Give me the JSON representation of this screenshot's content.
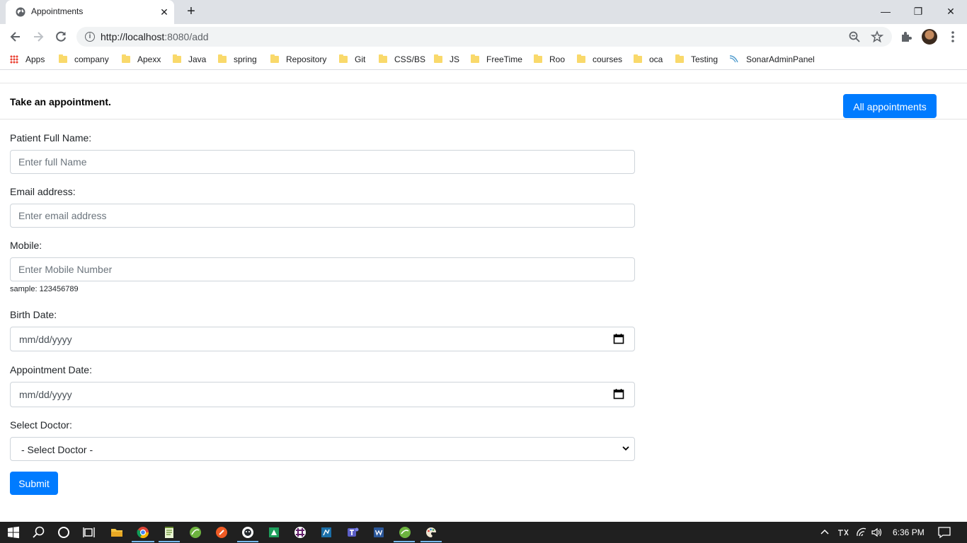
{
  "browser": {
    "tab_title": "Appointments",
    "new_tab_symbol": "+",
    "tab_close_symbol": "✕",
    "window_controls": {
      "minimize": "—",
      "restore": "❐",
      "close": "✕"
    },
    "url_host": "http://localhost",
    "url_path": ":8080/add",
    "bookmarks": [
      "Apps",
      "company",
      "Apexx",
      "Java",
      "spring",
      "Repository",
      "Git",
      "CSS/BS",
      "JS",
      "FreeTime",
      "Roo",
      "courses",
      "oca",
      "Testing",
      "SonarAdminPanel"
    ]
  },
  "page": {
    "title": "Take an appointment.",
    "all_appointments_label": "All appointments",
    "form": {
      "name_label": "Patient Full Name:",
      "name_placeholder": "Enter full Name",
      "email_label": "Email address:",
      "email_placeholder": "Enter email address",
      "mobile_label": "Mobile:",
      "mobile_placeholder": "Enter Mobile Number",
      "mobile_help": "sample: 123456789",
      "birth_label": "Birth Date:",
      "birth_value": "mm/dd/yyyy",
      "appointment_label": "Appointment Date:",
      "appointment_value": "mm/dd/yyyy",
      "doctor_label": "Select Doctor:",
      "doctor_selected": "- Select Doctor -",
      "submit_label": "Submit"
    }
  },
  "taskbar": {
    "time": "6:36 PM",
    "accent_color": "#76b9ed"
  },
  "colors": {
    "primary": "#007bff",
    "tabstrip": "#dee1e6",
    "taskbar": "#202020"
  }
}
